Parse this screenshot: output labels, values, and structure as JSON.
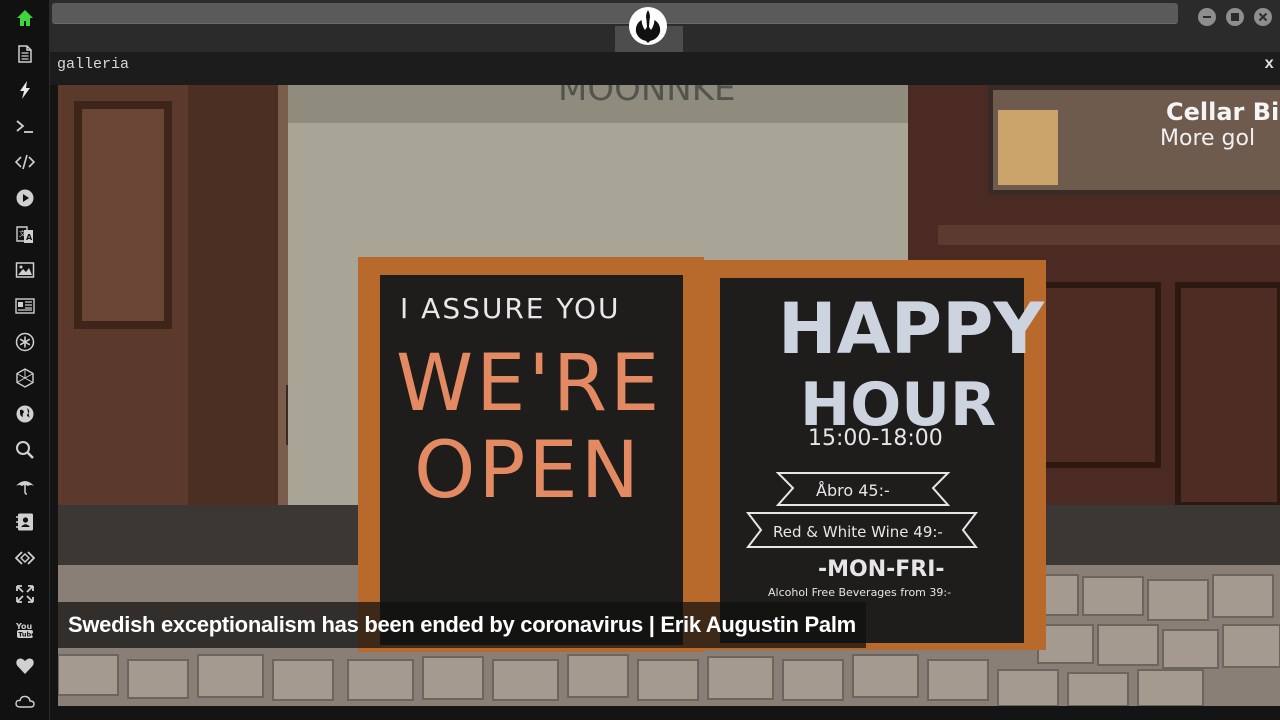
{
  "sidebar": {
    "items": [
      {
        "icon": "home-icon",
        "active": true
      },
      {
        "icon": "document-icon"
      },
      {
        "icon": "lightning-icon"
      },
      {
        "icon": "terminal-icon"
      },
      {
        "icon": "code-icon"
      },
      {
        "icon": "play-icon"
      },
      {
        "icon": "translate-icon"
      },
      {
        "icon": "image-icon"
      },
      {
        "icon": "newspaper-icon"
      },
      {
        "icon": "asterisk-icon"
      },
      {
        "icon": "hexagon-icon"
      },
      {
        "icon": "globe-icon"
      },
      {
        "icon": "search-icon"
      },
      {
        "icon": "umbrella-icon"
      },
      {
        "icon": "contact-book-icon"
      },
      {
        "icon": "diamond-code-icon"
      },
      {
        "icon": "expand-icon"
      },
      {
        "icon": "youtube-icon"
      },
      {
        "icon": "heart-icon"
      },
      {
        "icon": "cloud-icon"
      }
    ],
    "accent_color": "#3dd63d"
  },
  "topbar": {
    "logo": "rebel-alliance-logo",
    "window_controls": [
      "minimize",
      "maximize",
      "close"
    ]
  },
  "panel": {
    "title": "galleria",
    "close_label": "x"
  },
  "gallery": {
    "caption": "Swedish exceptionalism has been ended by coronavirus | Erik Augustin Palm",
    "image": {
      "left_board": [
        "I ASSURE YOU",
        "WE'RE",
        "OPEN"
      ],
      "right_board": [
        "HAPPY",
        "HOUR",
        "15:00-18:00",
        "Åbro 45:-",
        "Red & White Wine 49:-",
        "-MON-FRI-",
        "Alcohol Free Beverages from 39:-"
      ],
      "window_sign": [
        "Cellar Bi",
        "More gol"
      ]
    }
  }
}
